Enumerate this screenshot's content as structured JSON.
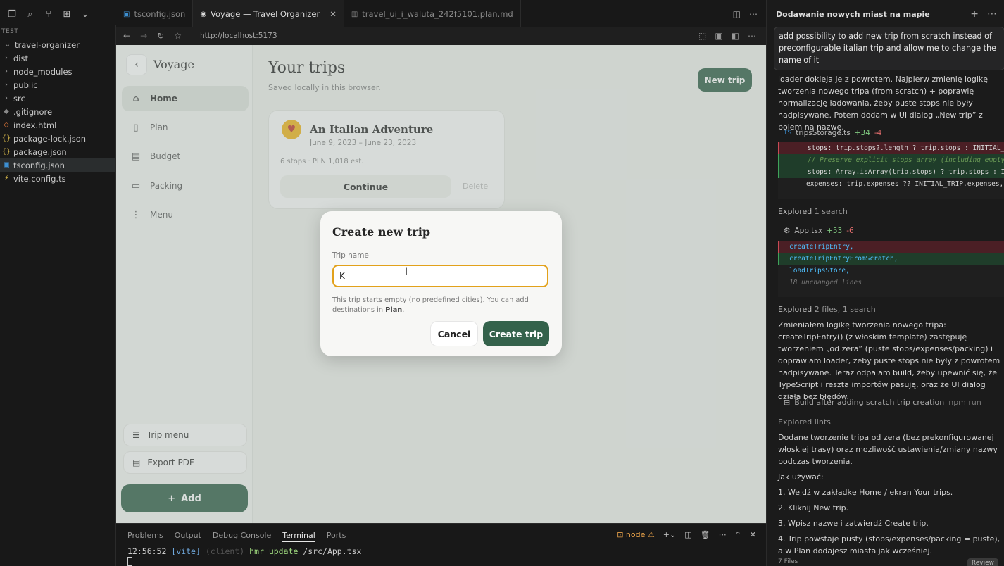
{
  "explorer": {
    "section": "TEST",
    "root": "travel-organizer",
    "items": [
      {
        "icon": "chevron-right",
        "label": "dist"
      },
      {
        "icon": "chevron-right",
        "label": "node_modules"
      },
      {
        "icon": "chevron-right",
        "label": "public"
      },
      {
        "icon": "chevron-right",
        "label": "src"
      },
      {
        "icon": "git",
        "label": ".gitignore"
      },
      {
        "icon": "html",
        "label": "index.html"
      },
      {
        "icon": "json",
        "label": "package-lock.json"
      },
      {
        "icon": "json",
        "label": "package.json"
      },
      {
        "icon": "ts",
        "label": "tsconfig.json"
      },
      {
        "icon": "vite",
        "label": "vite.config.ts"
      }
    ]
  },
  "tabs": [
    {
      "label": "tsconfig.json",
      "icon": "ts"
    },
    {
      "label": "Voyage — Travel Organizer",
      "icon": "globe",
      "active": true
    },
    {
      "label": "travel_ui_i_waluta_242f5101.plan.md",
      "icon": "md"
    }
  ],
  "browser": {
    "url": "http://localhost:5173"
  },
  "app": {
    "brand": "Voyage",
    "nav": [
      {
        "label": "Home",
        "icon": "home",
        "active": true
      },
      {
        "label": "Plan",
        "icon": "plan"
      },
      {
        "label": "Budget",
        "icon": "budget"
      },
      {
        "label": "Packing",
        "icon": "packing"
      },
      {
        "label": "Menu",
        "icon": "more"
      }
    ],
    "trip_menu": "Trip menu",
    "export_pdf": "Export PDF",
    "add": "Add",
    "page_title": "Your trips",
    "page_sub": "Saved locally in this browser.",
    "new_trip": "New trip",
    "trip": {
      "name": "An Italian Adventure",
      "dates": "June 9, 2023 – June 23, 2023",
      "meta": "6 stops · PLN 1,018 est.",
      "continue": "Continue",
      "delete": "Delete"
    },
    "dialog": {
      "title": "Create new trip",
      "label": "Trip name",
      "value": "K",
      "help_prefix": "This trip starts empty (no predefined cities). You can add destinations in ",
      "help_bold": "Plan",
      "help_suffix": ".",
      "cancel": "Cancel",
      "create": "Create trip"
    }
  },
  "panel": {
    "tabs": [
      "Problems",
      "Output",
      "Debug Console",
      "Terminal",
      "Ports"
    ],
    "active": "Terminal",
    "node": "node",
    "term_time": "12:56:52",
    "term_vite": "[vite]",
    "term_client": "(client)",
    "term_hmr": "hmr update",
    "term_path": "/src/App.tsx"
  },
  "chat": {
    "header": "Dodawanie nowych miast na mapie",
    "prompt": "add possibility to add new trip from scratch instead of preconfigurable italian trip and allow me to change the name of it",
    "p1": "loader dokleja je z powrotem. Najpierw zmienię logikę tworzenia nowego tripa (from scratch) + poprawię normalizację ładowania, żeby puste stops nie były nadpisywane. Potem dodam w UI dialog „New trip” z polem na nazwę.",
    "file1": {
      "name": "tripsStorage.ts",
      "plus": "+34",
      "minus": "-4"
    },
    "explored1": "Explored",
    "explored1_detail": "1 search",
    "file2": {
      "name": "App.tsx",
      "plus": "+53",
      "minus": "-6"
    },
    "diff2": [
      "createTripEntry,",
      "createTripEntryFromScratch,",
      "loadTripsStore,",
      "18 unchanged lines"
    ],
    "explored2": "Explored",
    "explored2_detail": "2 files, 1 search",
    "p2": "Zmieniałem logikę tworzenia nowego tripa: createTripEntry() (z włoskim template) zastępuję tworzeniem „od zera” (puste stops/expenses/packing) i doprawiam loader, żeby puste stops nie były z powrotem nadpisywane. Teraz odpalam build, żeby upewnić się, że TypeScript i reszta importów pasują, oraz że UI dialog działa bez błędów.",
    "build": "Build after adding scratch trip creation",
    "build_cmd": "npm run",
    "explored3": "Explored lints",
    "p3": "Dodane tworzenie tripa od zera (bez prekonfigurowanej włoskiej trasy) oraz możliwość ustawienia/zmiany nazwy podczas tworzenia.",
    "howto": "Jak używać:",
    "steps": [
      "Wejdź w zakładkę Home / ekran Your trips.",
      "Kliknij New trip.",
      "Wpisz nazwę i zatwierdź Create trip.",
      "Trip powstaje pusty (stops/expenses/packing = puste), a w Plan dodajesz miasta jak wcześniej."
    ],
    "files_footer": "7 Files",
    "review": "Review"
  }
}
